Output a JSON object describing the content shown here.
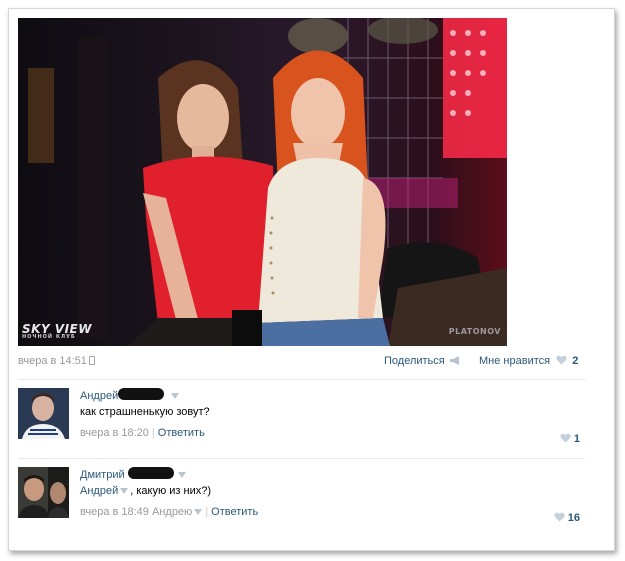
{
  "photo": {
    "watermark_left": "SKY VIEW",
    "watermark_left_sub": "НОЧНОЙ КЛУБ",
    "watermark_right": "PLATONOV"
  },
  "post": {
    "time": "вчера в 14:51",
    "share_label": "Поделиться",
    "like_label": "Мне нравится",
    "like_count": "2"
  },
  "comments": [
    {
      "author": "Андрей К",
      "text": "как страшненькую зовут?",
      "time": "вчера в 18:20",
      "reply_label": "Ответить",
      "likes": "1"
    },
    {
      "author": "Дмитрий",
      "mention": "Андрей",
      "text": ", какую из них?)",
      "time": "вчера в 18:49",
      "reply_to": "Андрею",
      "reply_label": "Ответить",
      "likes": "16"
    }
  ],
  "colors": {
    "link": "#2b587a",
    "muted": "#999999",
    "heart": "#c4d0dc"
  }
}
